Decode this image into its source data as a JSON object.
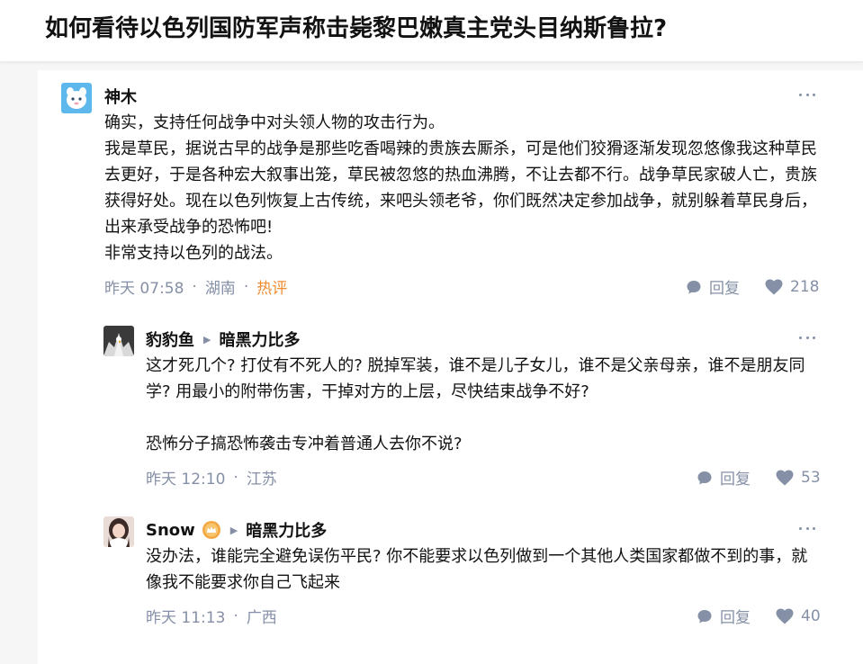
{
  "question": {
    "title": "如何看待以色列国防军声称击毙黎巴嫩真主党头目纳斯鲁拉?"
  },
  "comments": [
    {
      "author": "神木",
      "reply_to": "",
      "avatar_icon": "cartoon-avatar",
      "paragraphs": [
        "确实，支持任何战争中对头领人物的攻击行为。",
        "我是草民，据说古早的战争是那些吃香喝辣的贵族去厮杀，可是他们狡猾逐渐发现忽悠像我这种草民去更好，于是各种宏大叙事出笼，草民被忽悠的热血沸腾，不让去都不行。战争草民家破人亡，贵族获得好处。现在以色列恢复上古传统，来吧头领老爷，你们既然决定参加战争，就别躲着草民身后，出来承受战争的恐怖吧!",
        "非常支持以色列的战法。"
      ],
      "time": "昨天 07:58",
      "location": "湖南",
      "tag": "热评",
      "reply_label": "回复",
      "likes": "218"
    },
    {
      "author": "豹豹鱼",
      "reply_to": "暗黑力比多",
      "avatar_icon": "eagle-avatar",
      "paragraphs": [
        "这才死几个? 打仗有不死人的? 脱掉军装，谁不是儿子女儿，谁不是父亲母亲，谁不是朋友同学? 用最小的附带伤害，干掉对方的上层，尽快结束战争不好?",
        "",
        "恐怖分子搞恐怖袭击专冲着普通人去你不说?"
      ],
      "time": "昨天 12:10",
      "location": "江苏",
      "reply_label": "回复",
      "likes": "53"
    },
    {
      "author": "Snow",
      "reply_to": "暗黑力比多",
      "avatar_icon": "portrait-avatar",
      "badge_icon": "crown-badge-icon",
      "paragraphs": [
        "没办法，谁能完全避免误伤平民? 你不能要求以色列做到一个其他人类国家都做不到的事，就像我不能要求你自己飞起来"
      ],
      "time": "昨天 11:13",
      "location": "广西",
      "reply_label": "回复",
      "likes": "40"
    }
  ],
  "colors": {
    "text": "#121212",
    "meta": "#8590a6",
    "hot": "#f08c32",
    "background": "#f6f6f6"
  }
}
